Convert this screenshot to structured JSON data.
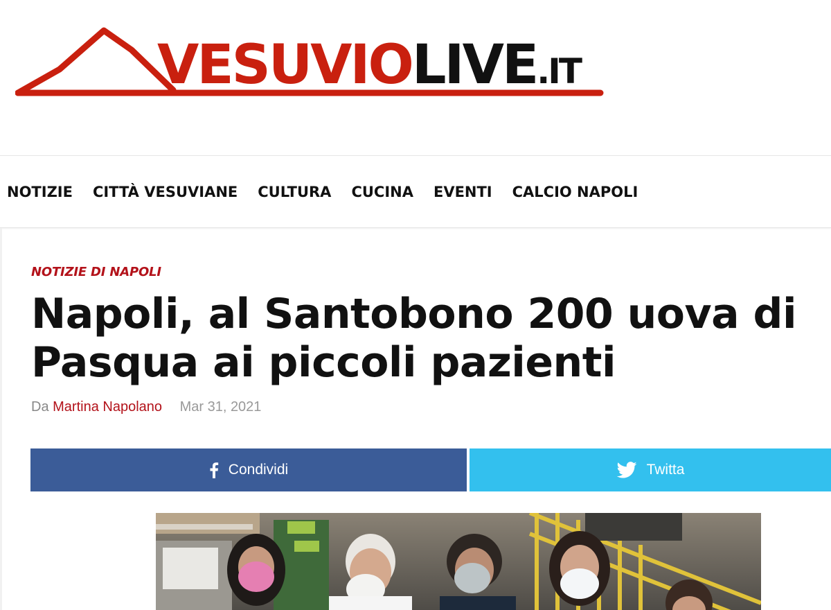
{
  "logo": {
    "part1": "VESUVIO",
    "part2": "LIVE",
    "part3": ".IT",
    "colors": {
      "red": "#c9200f",
      "black": "#111111"
    }
  },
  "nav": {
    "items": [
      "NOTIZIE",
      "CITTÀ VESUVIANE",
      "CULTURA",
      "CUCINA",
      "EVENTI",
      "CALCIO NAPOLI"
    ]
  },
  "article": {
    "category": "NOTIZIE DI NAPOLI",
    "title": "Napoli, al Santobono 200 uova di Pasqua ai piccoli pazienti",
    "byline_prefix": "Da",
    "author": "Martina Napolano",
    "date": "Mar 31, 2021"
  },
  "share": {
    "facebook_label": "Condividi",
    "twitter_label": "Twitta",
    "facebook_icon": "facebook-icon",
    "twitter_icon": "twitter-icon",
    "colors": {
      "facebook": "#3b5c98",
      "twitter": "#33c0ee"
    }
  },
  "colors": {
    "accent": "#b3121a"
  }
}
